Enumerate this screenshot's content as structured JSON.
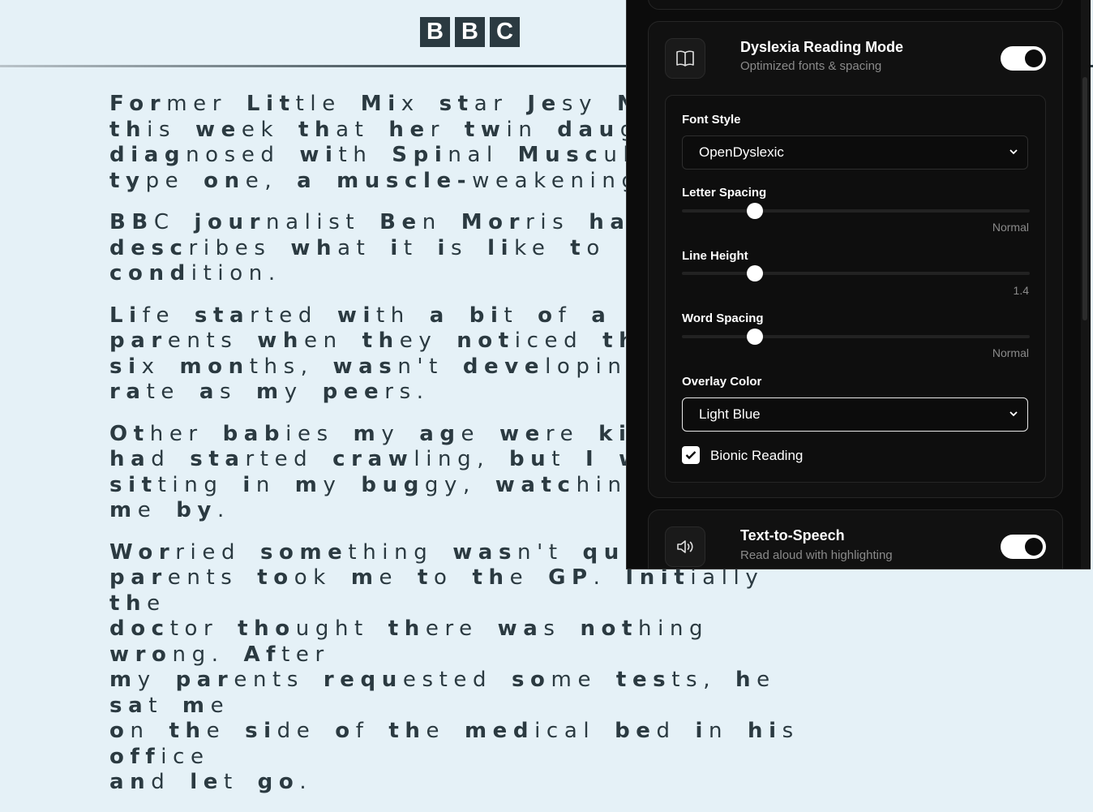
{
  "header": {
    "logo_letters": [
      "B",
      "B",
      "C"
    ]
  },
  "article": {
    "paragraphs": [
      "Former Little Mix star Jesy Nels\nthis week that her twin daughte\ndiagnosed with Spinal Muscular A\ntype one, a muscle-weakening dis",
      "BBC journalist Ben Morris has S\ndescribes what it is like to live\ncondition.",
      "Life started with a bit of a bum\nparents when they noticed that I\nsix months, wasn't developing at\nrate as my peers.",
      "Other babies my age were kicking\nhad started crawling, but I was c\nsitting in my buggy, watching the\nme by.",
      "Worried something wasn't quite ri\nparents took me to the GP. Initially the\ndoctor thought there was nothing wrong. After\nmy parents requested some tests, he sat me\non the side of the medical bed in his office\nand let go."
    ]
  },
  "panel": {
    "dyslexia": {
      "icon": "book-icon",
      "title": "Dyslexia Reading Mode",
      "subtitle": "Optimized fonts & spacing",
      "enabled": true,
      "font_style": {
        "label": "Font Style",
        "value": "OpenDyslexic"
      },
      "letter_spacing": {
        "label": "Letter Spacing",
        "value_text": "Normal",
        "level": 0.21
      },
      "line_height": {
        "label": "Line Height",
        "value_text": "1.4",
        "level": 0.21
      },
      "word_spacing": {
        "label": "Word Spacing",
        "value_text": "Normal",
        "level": 0.21
      },
      "overlay_color": {
        "label": "Overlay Color",
        "value": "Light Blue"
      },
      "bionic_reading": {
        "label": "Bionic Reading",
        "checked": true
      }
    },
    "tts": {
      "icon": "speaker-icon",
      "title": "Text-to-Speech",
      "subtitle": "Read aloud with highlighting",
      "enabled": true
    }
  },
  "colors": {
    "page_overlay": "#e5f1f7",
    "text": "#2b3a41",
    "panel_bg": "#0c0c0c"
  }
}
